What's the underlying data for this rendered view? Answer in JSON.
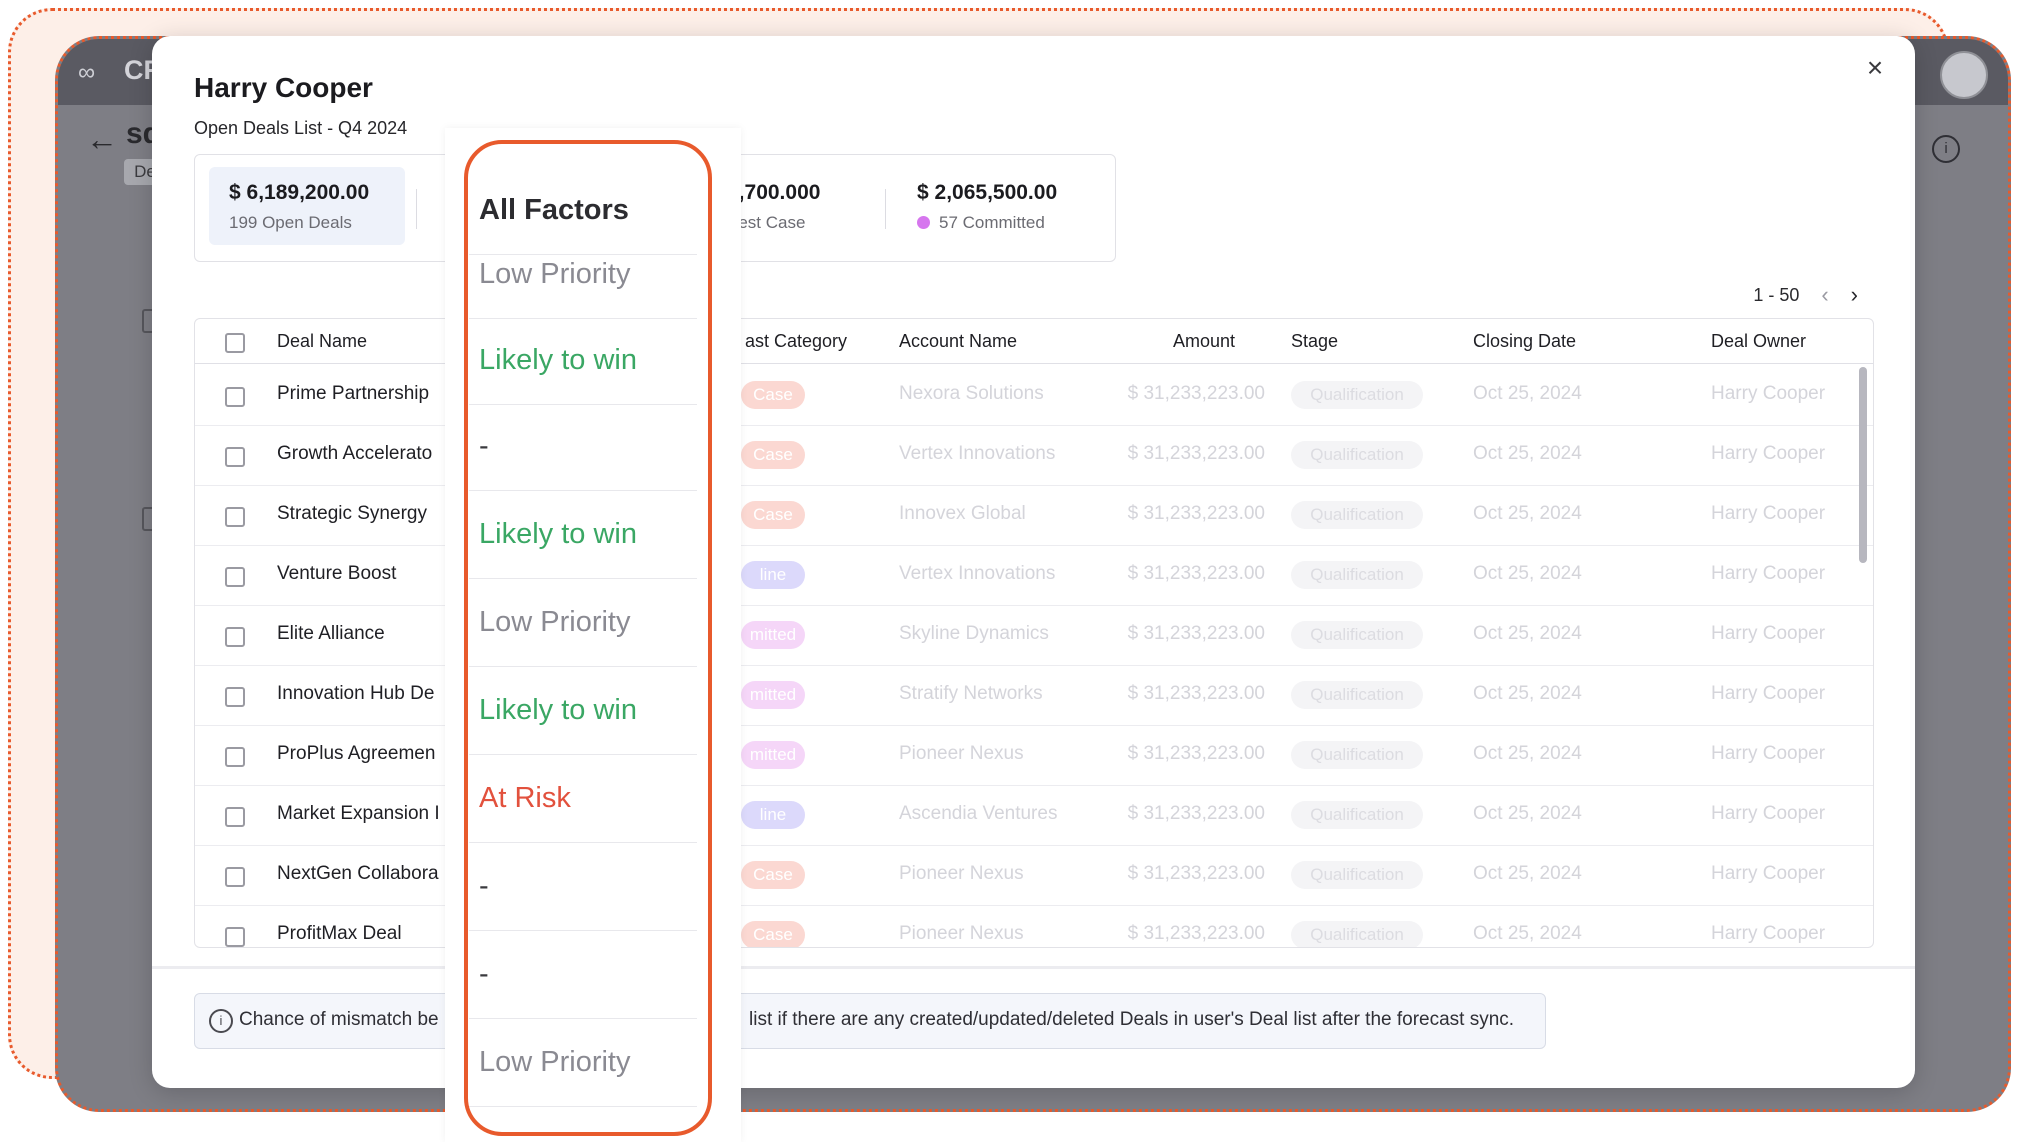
{
  "app": {
    "name": "CR",
    "record_short": "sd",
    "tag": "De"
  },
  "modal": {
    "title": "Harry Cooper",
    "subtitle": "Open Deals List - Q4 2024",
    "close_label": "×"
  },
  "stats": [
    {
      "value": "$ 6,189,200.00",
      "label": "199 Open Deals"
    },
    {
      "value": "3,700.000",
      "label": "Best Case"
    },
    {
      "value": "$ 2,065,500.00",
      "label": "57 Committed"
    }
  ],
  "pagination": {
    "range": "1 - 50",
    "prev": "‹",
    "next": "›"
  },
  "table": {
    "columns": [
      "Deal Name",
      "ast Category",
      "Account Name",
      "Amount",
      "Stage",
      "Closing Date",
      "Deal Owner"
    ],
    "rows": [
      {
        "deal": "Prime Partnership",
        "category": "Case",
        "category_color": "#fbd8d2",
        "account": "Nexora Solutions",
        "amount": "$ 31,233,223.00",
        "stage": "Qualification",
        "date": "Oct 25, 2024",
        "owner": "Harry Cooper"
      },
      {
        "deal": "Growth Accelerato",
        "category": "Case",
        "category_color": "#fbd8d2",
        "account": "Vertex Innovations",
        "amount": "$ 31,233,223.00",
        "stage": "Qualification",
        "date": "Oct 25, 2024",
        "owner": "Harry Cooper"
      },
      {
        "deal": "Strategic Synergy",
        "category": "Case",
        "category_color": "#fbd8d2",
        "account": "Innovex Global",
        "amount": "$ 31,233,223.00",
        "stage": "Qualification",
        "date": "Oct 25, 2024",
        "owner": "Harry Cooper"
      },
      {
        "deal": "Venture Boost",
        "category": "line",
        "category_color": "#dcd9fb",
        "account": "Vertex Innovations",
        "amount": "$ 31,233,223.00",
        "stage": "Qualification",
        "date": "Oct 25, 2024",
        "owner": "Harry Cooper"
      },
      {
        "deal": "Elite Alliance",
        "category": "mitted",
        "category_color": "#f5d6f8",
        "account": "Skyline Dynamics",
        "amount": "$ 31,233,223.00",
        "stage": "Qualification",
        "date": "Oct 25, 2024",
        "owner": "Harry Cooper"
      },
      {
        "deal": "Innovation Hub De",
        "category": "mitted",
        "category_color": "#f5d6f8",
        "account": "Stratify Networks",
        "amount": "$ 31,233,223.00",
        "stage": "Qualification",
        "date": "Oct 25, 2024",
        "owner": "Harry Cooper"
      },
      {
        "deal": "ProPlus Agreemen",
        "category": "mitted",
        "category_color": "#f5d6f8",
        "account": "Pioneer Nexus",
        "amount": "$ 31,233,223.00",
        "stage": "Qualification",
        "date": "Oct 25, 2024",
        "owner": "Harry Cooper"
      },
      {
        "deal": "Market Expansion I",
        "category": "line",
        "category_color": "#dcd9fb",
        "account": "Ascendia Ventures",
        "amount": "$ 31,233,223.00",
        "stage": "Qualification",
        "date": "Oct 25, 2024",
        "owner": "Harry Cooper"
      },
      {
        "deal": "NextGen Collabora",
        "category": "Case",
        "category_color": "#fbd8d2",
        "account": "Pioneer Nexus",
        "amount": "$ 31,233,223.00",
        "stage": "Qualification",
        "date": "Oct 25, 2024",
        "owner": "Harry Cooper"
      },
      {
        "deal": "ProfitMax Deal",
        "category": "Case",
        "category_color": "#fbd8d2",
        "account": "Pioneer Nexus",
        "amount": "$ 31,233,223.00",
        "stage": "Qualification",
        "date": "Oct 25, 2024",
        "owner": "Harry Cooper"
      }
    ]
  },
  "footer": {
    "note_left": "Chance of mismatch be",
    "note_right": "list if there are any created/updated/deleted Deals in user's Deal list after the forecast sync."
  },
  "dropdown": {
    "items": [
      {
        "label": "All Factors",
        "kind": "all"
      },
      {
        "label": "Low Priority",
        "kind": "low"
      },
      {
        "label": "Likely to win",
        "kind": "likely"
      },
      {
        "label": "-",
        "kind": "dash"
      },
      {
        "label": "Likely to win",
        "kind": "likely"
      },
      {
        "label": "Low Priority",
        "kind": "low"
      },
      {
        "label": "Likely to win",
        "kind": "likely"
      },
      {
        "label": "At Risk",
        "kind": "risk"
      },
      {
        "label": "-",
        "kind": "dash"
      },
      {
        "label": "-",
        "kind": "dash"
      },
      {
        "label": "Low Priority",
        "kind": "low"
      }
    ]
  },
  "colors": {
    "accent_highlight": "#e85a2c",
    "likely": "#3aa764",
    "risk": "#e2513d",
    "committed_dot": "#d676ee"
  },
  "icons": [
    "crm-logo-icon",
    "back-arrow-icon",
    "info-icon",
    "close-icon",
    "chevron-left-icon",
    "chevron-right-icon",
    "checkbox-icon"
  ]
}
